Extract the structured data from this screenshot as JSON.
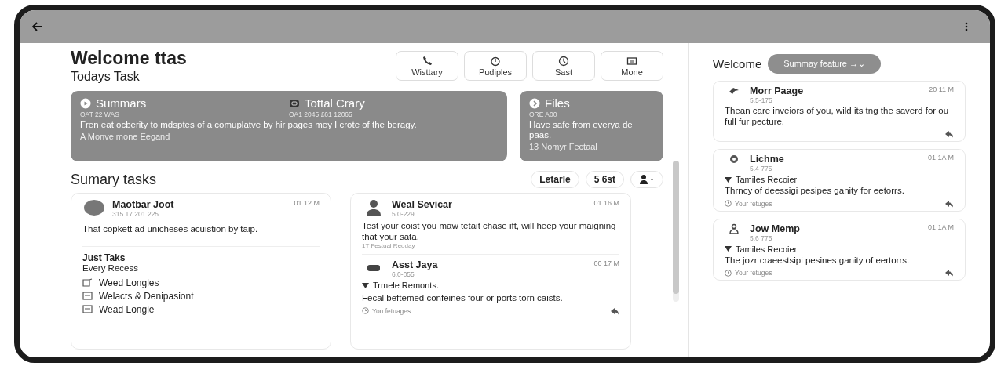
{
  "header": {
    "title": "Welcome ttas",
    "subtitle": "Todays Task"
  },
  "actions": [
    {
      "label": "Wisttary"
    },
    {
      "label": "Pudiples"
    },
    {
      "label": "Sast"
    },
    {
      "label": "Mone"
    }
  ],
  "summary_cards": [
    {
      "headings": [
        {
          "title": "Summars",
          "meta": "OAT 22 WAS"
        },
        {
          "title": "Tottal Crary",
          "meta": "OA1 2045 £61 12065"
        }
      ],
      "body": "Fren eat ocberity to mdsptes of a comuplatve by hir pages mey I crote of the beragy.",
      "footer": "A Monve mone Eegand"
    },
    {
      "headings": [
        {
          "title": "Files",
          "meta": "ORE A00"
        }
      ],
      "body": "Have safe from everya de paas.",
      "footer": "13 Nomyr Fectaal"
    }
  ],
  "tasks": {
    "title": "Sumary tasks",
    "filters": [
      "Letarle",
      "5 6st"
    ]
  },
  "task_card": {
    "name": "Maotbar Joot",
    "meta": "315 17 201 225",
    "time": "01 12 M",
    "body": "That copkett ad unicheses acuistion by taip.",
    "subheading": "Just Taks",
    "subtext": "Every Recess",
    "items": [
      {
        "label": "Weed Longles"
      },
      {
        "label": "Welacts & Denipasiont"
      },
      {
        "label": "Wead Longle"
      }
    ]
  },
  "messages": [
    {
      "name": "Weal Sevicar",
      "meta": "5.0-229",
      "time": "01 16 M",
      "body": "Test your coist you maw tetait chase ift, will heep your maigning that your sata.",
      "note": "1T Festual Redday"
    },
    {
      "name": "Asst Jaya",
      "meta": "6.0-055",
      "time": "00 17 M",
      "tag": "Trmele Remonts.",
      "body": "Fecal beftemed confeines four or ports torn caists.",
      "footer": "You fetuages"
    }
  ],
  "side": {
    "title": "Welcome",
    "button": "Summay feature →⌄",
    "cards": [
      {
        "name": "Morr Paage",
        "meta": "5.5-175",
        "time": "20 11 M",
        "body": "Thean care inveiors of you, wild its tng the saverd for ou full fur pecture."
      },
      {
        "name": "Lichme",
        "meta": "5.4 775",
        "time": "01 1A M",
        "tag": "Tamiles Recoier",
        "body": "Thrncy of deessigi pesipes ganity for eetorrs.",
        "footer": "Your fetuges"
      },
      {
        "name": "Jow Memp",
        "meta": "5.6 775",
        "time": "01 1A M",
        "tag": "Tamiles Recoier",
        "body": "The jozr craeestsipi pesines ganity of eertorrs.",
        "footer": "Your fetuges"
      }
    ]
  }
}
